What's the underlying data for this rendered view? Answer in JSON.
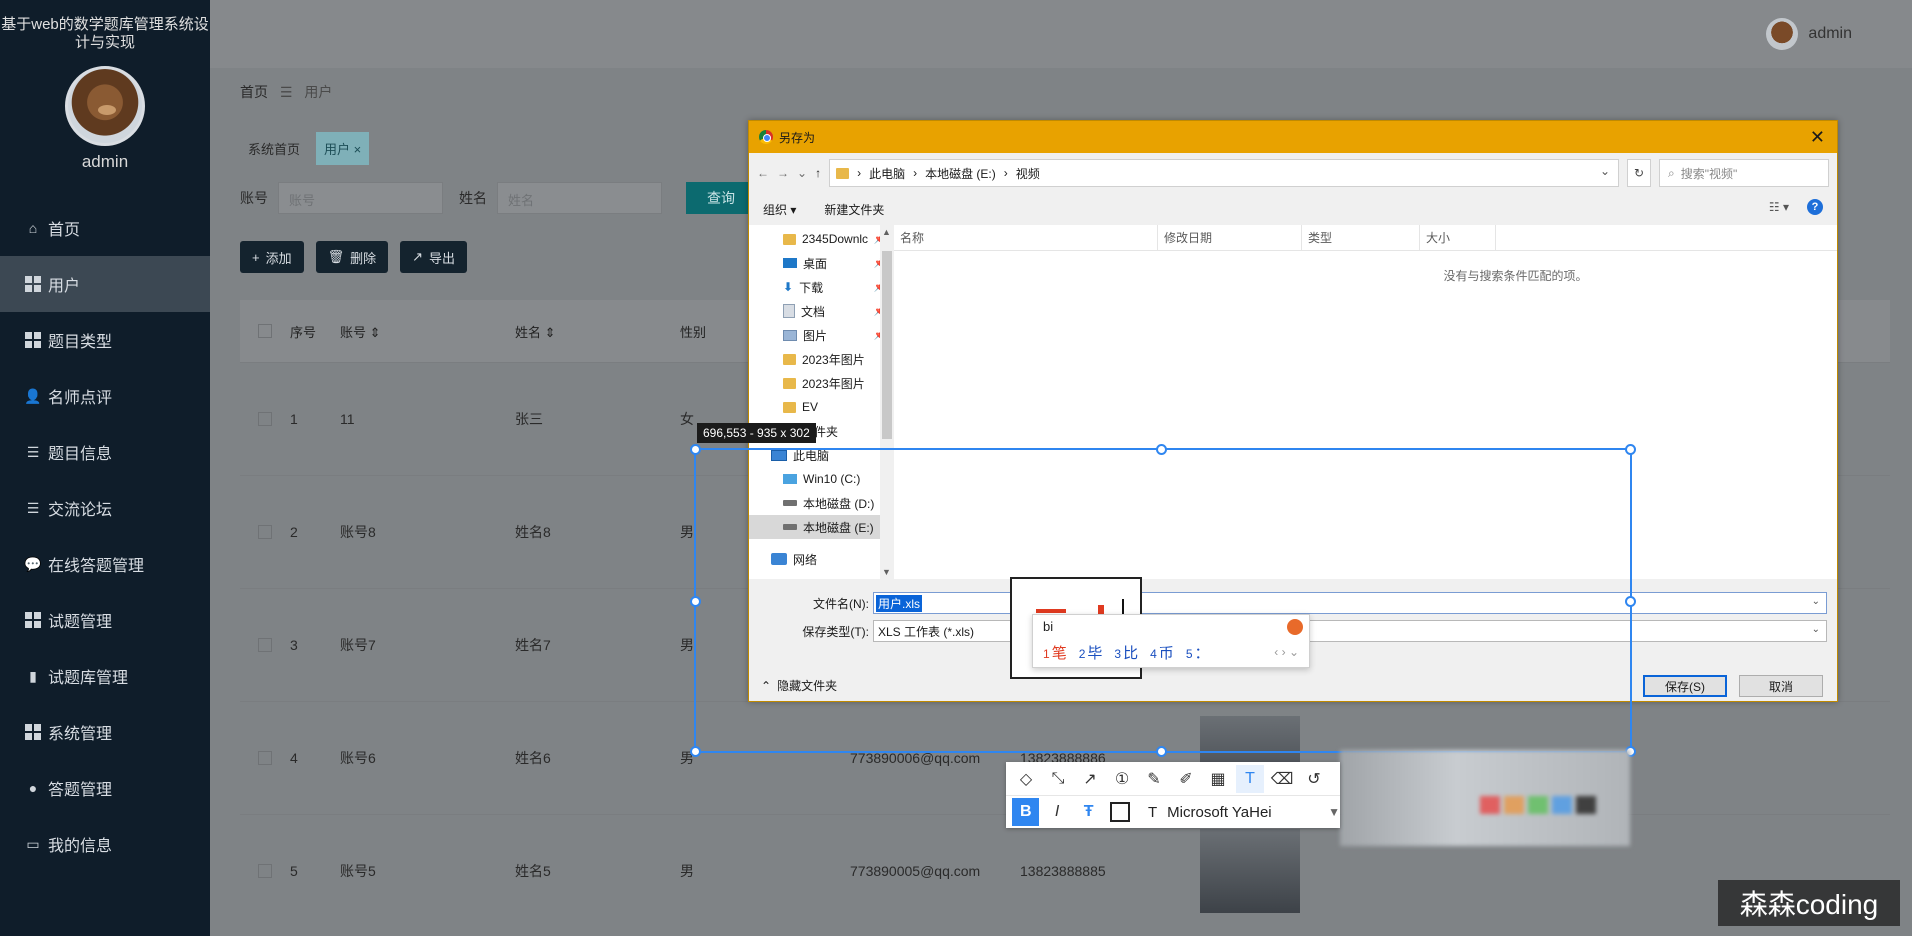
{
  "app": {
    "system_title": "基于web的数学题库管理系统设计与实现",
    "sidebar_user": "admin",
    "top_user": "admin"
  },
  "sidebar": {
    "items": [
      {
        "label": "首页",
        "icon": "home-icon"
      },
      {
        "label": "用户",
        "icon": "grid-icon",
        "active": true
      },
      {
        "label": "题目类型",
        "icon": "grid-icon"
      },
      {
        "label": "名师点评",
        "icon": "user-icon"
      },
      {
        "label": "题目信息",
        "icon": "list-icon"
      },
      {
        "label": "交流论坛",
        "icon": "list-icon"
      },
      {
        "label": "在线答题管理",
        "icon": "comment-icon"
      },
      {
        "label": "试题管理",
        "icon": "grid-icon"
      },
      {
        "label": "试题库管理",
        "icon": "bar-chart-icon"
      },
      {
        "label": "系统管理",
        "icon": "grid-icon"
      },
      {
        "label": "答题管理",
        "icon": "bulb-icon"
      },
      {
        "label": "我的信息",
        "icon": "card-icon"
      }
    ]
  },
  "breadcrumb": {
    "home": "首页",
    "sep": "☰",
    "current": "用户"
  },
  "tabs": [
    {
      "label": "系统首页"
    },
    {
      "label": "用户 ×"
    }
  ],
  "search": {
    "account_label": "账号",
    "account_placeholder": "账号",
    "name_label": "姓名",
    "name_placeholder": "姓名",
    "query_button": "查询"
  },
  "actions": {
    "add": "添加",
    "delete": "删除",
    "export": "导出"
  },
  "table": {
    "headers": {
      "no": "序号",
      "account": "账号",
      "name": "姓名",
      "sex": "性别"
    },
    "rows": [
      {
        "no": "1",
        "account": "11",
        "name": "张三",
        "sex": "女",
        "email": "",
        "phone": ""
      },
      {
        "no": "2",
        "account": "账号8",
        "name": "姓名8",
        "sex": "男",
        "email": "",
        "phone": ""
      },
      {
        "no": "3",
        "account": "账号7",
        "name": "姓名7",
        "sex": "男",
        "email": "",
        "phone": ""
      },
      {
        "no": "4",
        "account": "账号6",
        "name": "姓名6",
        "sex": "男",
        "email": "773890006@qq.com",
        "phone": "13823888886"
      },
      {
        "no": "5",
        "account": "账号5",
        "name": "姓名5",
        "sex": "男",
        "email": "773890005@qq.com",
        "phone": "13823888885"
      }
    ]
  },
  "dialog": {
    "title": "另存为",
    "path": [
      "此电脑",
      "本地磁盘 (E:)",
      "视频"
    ],
    "search_placeholder": "搜索\"视频\"",
    "organize": "组织 ▾",
    "new_folder": "新建文件夹",
    "nav_items": [
      {
        "label": "2345Downlc",
        "icon": "folder-icon",
        "pinned": true
      },
      {
        "label": "桌面",
        "icon": "desktop-icon",
        "pinned": true
      },
      {
        "label": "下载",
        "icon": "download-icon",
        "pinned": true
      },
      {
        "label": "文档",
        "icon": "document-icon",
        "pinned": true
      },
      {
        "label": "图片",
        "icon": "picture-icon",
        "pinned": true
      },
      {
        "label": "2023年图片",
        "icon": "folder-icon"
      },
      {
        "label": "2023年图片",
        "icon": "folder-icon"
      },
      {
        "label": "EV",
        "icon": "folder-icon"
      },
      {
        "label": "文件夹",
        "icon": "folder-icon"
      }
    ],
    "tree": [
      {
        "label": "此电脑",
        "icon": "computer-icon",
        "root": true
      },
      {
        "label": "Win10 (C:)",
        "icon": "windows-drive-icon"
      },
      {
        "label": "本地磁盘 (D:)",
        "icon": "drive-icon"
      },
      {
        "label": "本地磁盘 (E:)",
        "icon": "drive-icon",
        "selected": true
      },
      {
        "label": "网络",
        "icon": "network-icon",
        "root": true
      }
    ],
    "columns": {
      "name": "名称",
      "modified": "修改日期",
      "type": "类型",
      "size": "大小"
    },
    "empty_text": "没有与搜索条件匹配的项。",
    "filename_label": "文件名(N):",
    "filename_value": "用户.xls",
    "filetype_label": "保存类型(T):",
    "filetype_value": "XLS 工作表 (*.xls)",
    "hide_folders": "隐藏文件夹",
    "save_button": "保存(S)",
    "cancel_button": "取消"
  },
  "capture": {
    "size_readout": "696,553 - 935 x 302",
    "font_name": "Microsoft YaHei",
    "accent_color": "#2f86f0"
  },
  "ime": {
    "pinyin": "bi",
    "candidates": [
      {
        "n": "1",
        "text": "笔"
      },
      {
        "n": "2",
        "text": "毕"
      },
      {
        "n": "3",
        "text": "比"
      },
      {
        "n": "4",
        "text": "币"
      },
      {
        "n": "5",
        "text": "："
      }
    ]
  },
  "watermark": "森森coding"
}
